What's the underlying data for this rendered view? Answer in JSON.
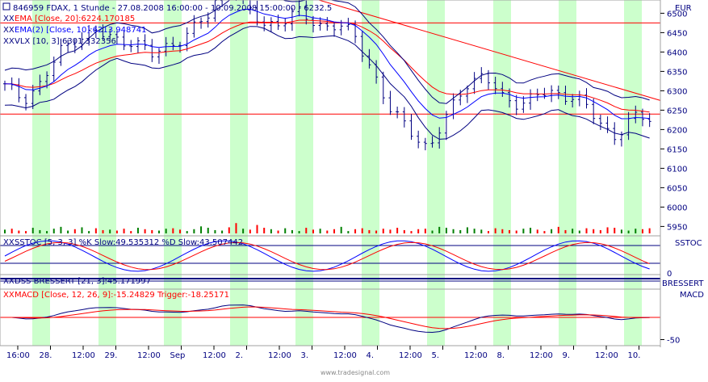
{
  "colors": {
    "band": "#ccffcc",
    "price": "#000080",
    "ema20": "#ff0000",
    "ema10": "#0000ff",
    "vlx": "#000080",
    "grid": "#000000",
    "volume_up": "#008000",
    "volume_down": "#ff0000",
    "macd": "#000080",
    "trigger": "#ff0000"
  },
  "header": {
    "symbol_line": "846959  FDAX, 1 Stunde - 27.08.2008 16:00:00 - 10.09.2008 15:00:00 - 6232.5",
    "ema20_line": "EMA [Close, 20]:6224.170185",
    "ema10_line": "EMA(2) [Close, 10]:6213.948741",
    "vlx_line": "VLX [10, 3]:6301.332356",
    "close_marker": "XX"
  },
  "panels": {
    "price_unit": "EUR",
    "sstoc_label": "SSTOC",
    "sstoc_title": "SSTOC [5, 3, 3]  %K Slow:49.535312  %D Slow:43.507442",
    "indicator_title": "DSS-BRESSERT [21, 3]:45.171997",
    "indicator_label": "BRESSERT",
    "macd_label": "MACD",
    "macd_title": "MACD [Close, 12, 26, 9]:-15.24829  Trigger:-18.25171"
  },
  "footer": {
    "watermark": "www.tradesignal.com"
  },
  "chart_data": [
    {
      "type": "candlestick",
      "title": "846959  FDAX, 1 Stunde - 27.08.2008 16:00:00 - 10.09.2008 15:00:00 - 6232.5",
      "ylabel": "EUR",
      "ylim": [
        5930,
        6530
      ],
      "yticks": [
        5950,
        6000,
        6050,
        6100,
        6150,
        6200,
        6250,
        6300,
        6350,
        6400,
        6450,
        6500
      ],
      "xticks": [
        "16:00",
        "28.",
        "12:00",
        "29.",
        "12:00",
        "Sep",
        "12:00",
        "2.",
        "12:00",
        "3.",
        "12:00",
        "4.",
        "12:00",
        "5.",
        "12:00",
        "8.",
        "12:00",
        "9.",
        "12:00",
        "10."
      ],
      "horizontal_lines": [
        6475,
        6240
      ],
      "trendline": {
        "from": 6580,
        "to": 6275
      },
      "close_anchors": [
        6310,
        6280,
        6320,
        6400,
        6440,
        6450,
        6430,
        6430,
        6390,
        6420,
        6450,
        6490,
        6580,
        6520,
        6470,
        6480,
        6500,
        6470,
        6470,
        6440,
        6350,
        6240,
        6200,
        6150,
        6230,
        6320,
        6340,
        6280,
        6270,
        6290,
        6290,
        6290,
        6230,
        6180,
        6230,
        6225
      ],
      "series": [
        {
          "name": "EMA [Close, 20]",
          "last": 6224.170185
        },
        {
          "name": "EMA(2) [Close, 10]",
          "last": 6213.948741
        },
        {
          "name": "VLX [10, 3]",
          "last": 6301.332356
        }
      ]
    },
    {
      "type": "bar",
      "title": "Volume",
      "volume_scale": [
        0.08,
        0.1,
        0.06,
        0.05,
        0.12,
        0.07,
        0.05,
        0.1,
        0.14,
        0.06,
        0.09,
        0.13,
        0.05,
        0.11,
        0.07,
        0.08,
        0.06,
        0.1,
        0.05,
        0.12,
        0.09,
        0.07,
        0.06,
        0.1,
        0.11,
        0.08,
        0.05,
        0.09,
        0.15,
        0.12,
        0.07,
        0.06,
        0.13,
        0.22,
        0.1,
        0.08,
        0.18,
        0.12,
        0.09,
        0.06,
        0.11,
        0.07,
        0.05,
        0.12,
        0.08,
        0.1,
        0.06,
        0.09,
        0.14,
        0.05,
        0.09,
        0.11,
        0.07,
        0.06,
        0.1,
        0.08,
        0.12,
        0.07,
        0.05,
        0.09,
        0.1,
        0.06,
        0.14,
        0.12,
        0.09,
        0.07,
        0.13,
        0.1,
        0.08,
        0.05,
        0.11,
        0.09,
        0.07,
        0.06,
        0.1,
        0.12,
        0.08,
        0.05,
        0.09,
        0.14,
        0.07,
        0.1,
        0.06,
        0.11,
        0.09,
        0.07,
        0.13,
        0.12,
        0.08,
        0.06,
        0.1,
        0.09,
        0.11,
        0.07,
        0.05,
        0.12,
        0.08,
        0.1,
        0.06,
        0.09,
        0.14,
        0.11,
        0.07,
        0.05,
        0.1,
        0.12,
        0.08,
        0.06,
        0.09,
        0.13,
        0.1,
        0.07,
        0.11,
        0.08,
        0.05,
        0.09,
        0.12,
        0.1,
        0.07,
        0.06,
        0.11,
        0.09,
        0.12,
        0.08,
        0.1,
        0.07,
        0.05,
        0.09,
        0.13,
        0.1,
        0.08,
        0.06,
        0.11,
        0.09,
        0.12,
        0.07,
        0.1,
        0.08,
        0.14,
        0.11,
        0.09,
        0.06,
        0.12,
        0.1,
        0.08,
        0.07,
        0.11,
        0.09,
        0.13,
        0.1,
        0.12,
        0.15,
        0.18,
        0.22,
        0.16,
        0.2,
        0.25,
        0.19,
        0.12,
        0.1,
        0.4,
        0.5,
        0.45,
        0.3,
        0.22,
        0.18,
        0.35,
        0.55,
        0.6,
        0.5,
        0.33,
        0.24,
        0.2,
        0.18,
        0.15,
        0.12,
        0.26,
        0.3,
        0.22,
        0.18,
        0.2,
        0.25,
        0.3,
        0.45,
        0.55,
        0.6,
        0.75,
        0.7,
        0.8,
        0.55,
        0.6,
        0.9,
        0.65,
        0.5,
        0.45,
        0.35,
        0.3,
        0.4,
        0.55,
        0.65,
        0.7,
        0.95,
        0.85,
        0.7,
        0.45,
        0.25,
        0.3,
        0.35,
        0.28,
        0.22,
        0.3,
        0.4,
        0.5,
        0.55,
        0.45,
        0.38,
        0.3,
        0.25,
        0.22,
        0.35,
        0.4,
        0.3,
        0.28,
        0.42,
        0.35,
        0.3,
        0.25,
        0.2,
        0.25,
        0.3,
        0.22,
        0.3,
        0.35,
        0.28,
        0.25,
        0.3,
        0.4,
        0.45,
        0.35,
        0.3,
        0.25,
        0.3,
        0.35,
        0.28,
        0.22,
        0.2,
        0.24,
        0.3,
        0.4,
        0.45,
        0.95,
        0.85,
        1.0,
        0.8
      ]
    },
    {
      "type": "line",
      "title": "SSTOC [5, 3, 3]",
      "yticks": [
        0
      ],
      "series": [
        {
          "name": "%K Slow",
          "last": 49.535312
        },
        {
          "name": "%D Slow",
          "last": 43.507442
        }
      ]
    },
    {
      "type": "line",
      "title": "DSS-BRESSERT [21, 3]",
      "series": [
        {
          "name": "DSS-BRESSERT",
          "last": 45.171997
        }
      ]
    },
    {
      "type": "line",
      "title": "MACD [Close, 12, 26, 9]",
      "yticks": [
        -50
      ],
      "series": [
        {
          "name": "MACD",
          "last": -15.24829
        },
        {
          "name": "Trigger",
          "last": -18.25171
        }
      ]
    }
  ]
}
